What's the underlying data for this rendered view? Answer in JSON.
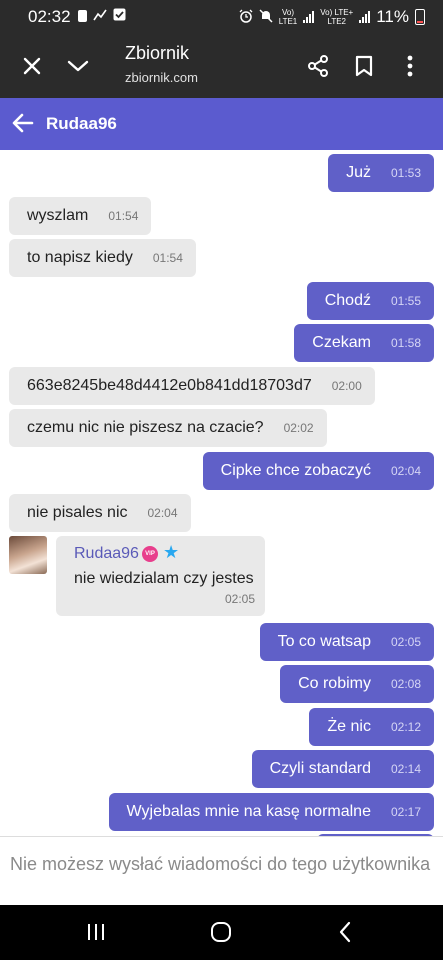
{
  "status_bar": {
    "time": "02:32",
    "left_icons": [
      "sim-alert-icon",
      "signal-slash-icon",
      "check-box-icon"
    ],
    "net1": {
      "top": "Vo)",
      "bottom": "LTE1"
    },
    "net2": {
      "top": "Vo) LTE+",
      "bottom": "LTE2"
    },
    "battery": "11%"
  },
  "browser": {
    "title": "Zbiornik",
    "url": "zbiornik.com"
  },
  "chat": {
    "username": "Rudaa96",
    "messages": [
      {
        "dir": "out",
        "text": "Już",
        "time": "01:53"
      },
      {
        "dir": "in",
        "text": "wyszlam",
        "time": "01:54"
      },
      {
        "dir": "in",
        "text": "to napisz kiedy",
        "time": "01:54"
      },
      {
        "dir": "out",
        "text": "Chodź",
        "time": "01:55"
      },
      {
        "dir": "out",
        "text": "Czekam",
        "time": "01:58"
      },
      {
        "dir": "in",
        "text": "663e8245be48d4412e0b841dd18703d7",
        "time": "02:00"
      },
      {
        "dir": "in",
        "text": "czemu nic nie piszesz na czacie?",
        "time": "02:02"
      },
      {
        "dir": "out",
        "text": "Cipke chce zobaczyć",
        "time": "02:04"
      },
      {
        "dir": "in",
        "text": "nie pisales nic",
        "time": "02:04"
      },
      {
        "dir": "out",
        "text": "To co watsap",
        "time": "02:05"
      },
      {
        "dir": "out",
        "text": "Co robimy",
        "time": "02:08"
      },
      {
        "dir": "out",
        "text": "Że nic",
        "time": "02:12"
      },
      {
        "dir": "out",
        "text": "Czyli standard",
        "time": "02:14"
      },
      {
        "dir": "out",
        "text": "Wyjebalas mnie na kasę normalne",
        "time": "02:17"
      }
    ],
    "card": {
      "name": "Rudaa96",
      "badge": "VIP",
      "text": "nie wiedzialam czy jestes",
      "time": "02:05"
    },
    "notice": "Nie możesz wysłać wiadomości do tego użytkownika"
  },
  "colors": {
    "header": "#5b5bcf",
    "outgoing": "#6060c8",
    "incoming": "#e9e9e9",
    "toolbar": "#2b2b2b"
  }
}
